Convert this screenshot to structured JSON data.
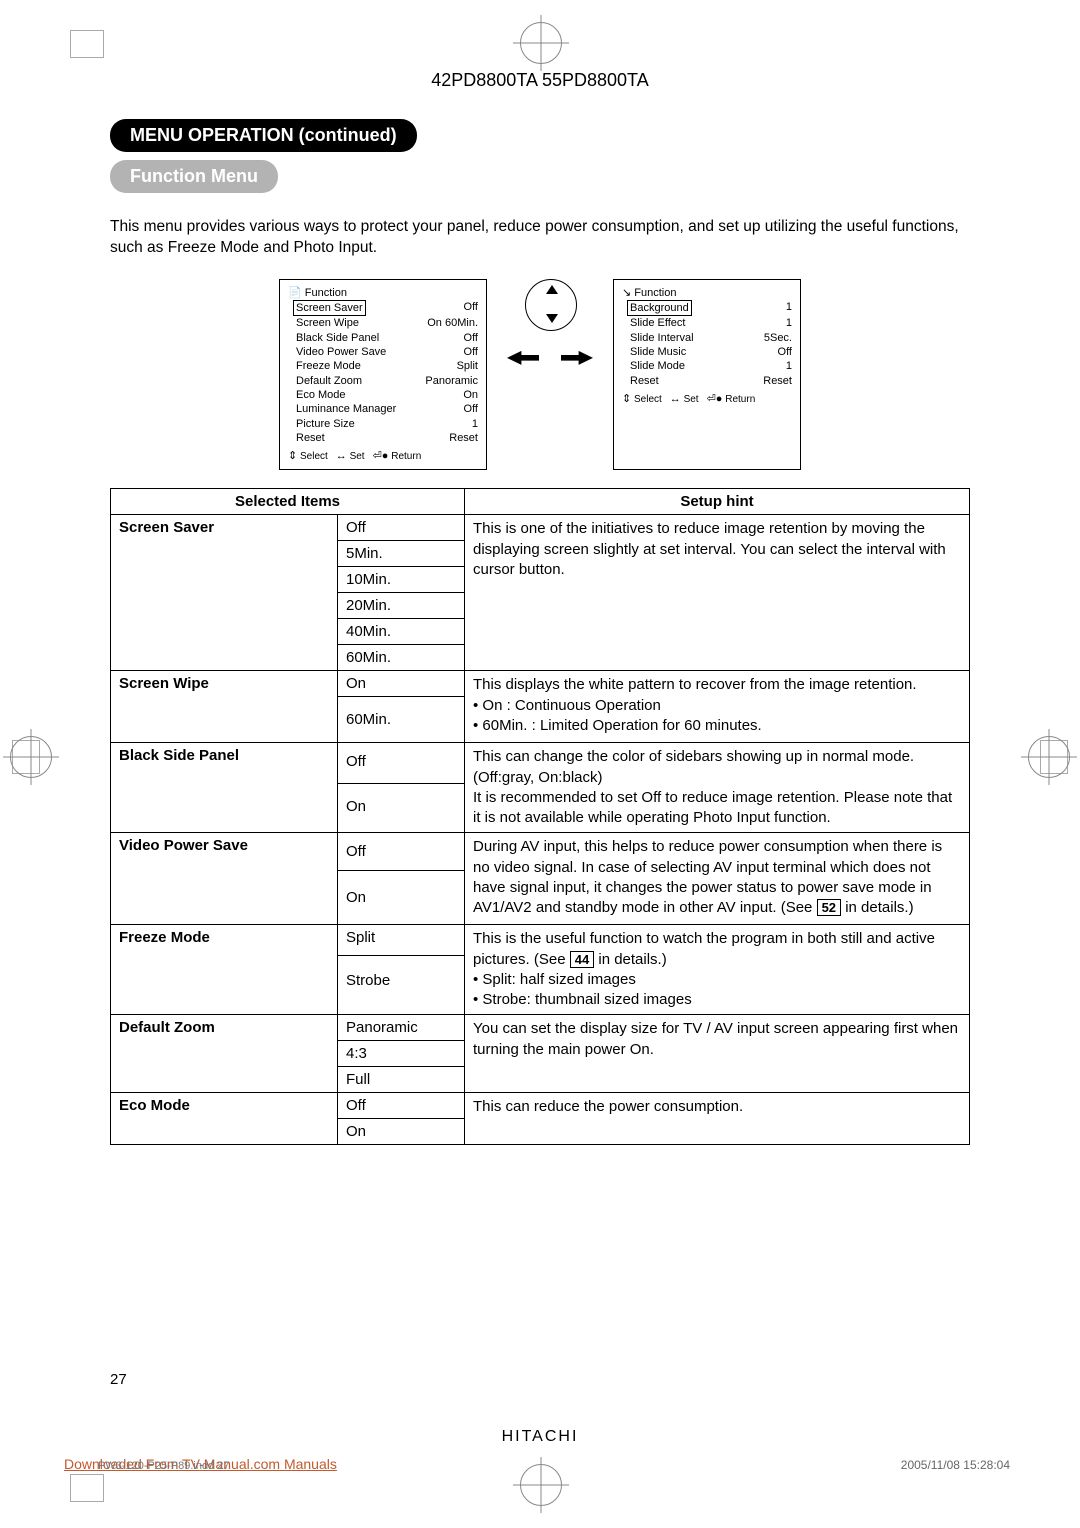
{
  "doc": {
    "model": "42PD8800TA  55PD8800TA",
    "title_pill": "MENU OPERATION (continued)",
    "subtitle_pill": "Function Menu",
    "intro": "This menu provides various ways to protect your panel, reduce power consumption, and set up utilizing the useful functions, such as Freeze Mode and Photo Input.",
    "page_number": "27",
    "brand": "HITACHI",
    "download_link": "Downloaded From TV-Manual.com Manuals",
    "imprint": "PW3-120-P25-P89.indd   27",
    "print_date": "2005/11/08   15:28:04"
  },
  "osd1": {
    "title": "Function",
    "rows": [
      {
        "label": "Screen Saver",
        "value": "Off",
        "selected": true
      },
      {
        "label": "Screen Wipe",
        "value": "On 60Min."
      },
      {
        "label": "Black Side Panel",
        "value": "Off"
      },
      {
        "label": "Video Power Save",
        "value": "Off"
      },
      {
        "label": "Freeze Mode",
        "value": "Split"
      },
      {
        "label": "Default Zoom",
        "value": "Panoramic"
      },
      {
        "label": "Eco Mode",
        "value": "On"
      },
      {
        "label": "Luminance Manager",
        "value": "Off"
      },
      {
        "label": "Picture Size",
        "value": "1"
      },
      {
        "label": "Reset",
        "value": "Reset"
      }
    ],
    "hints": {
      "select": "Select",
      "set": "Set",
      "ret": "Return"
    }
  },
  "osd2": {
    "title": "Function",
    "rows": [
      {
        "label": "Background",
        "value": "1",
        "selected": true
      },
      {
        "label": "Slide Effect",
        "value": "1"
      },
      {
        "label": "Slide Interval",
        "value": "5Sec."
      },
      {
        "label": "Slide Music",
        "value": "Off"
      },
      {
        "label": "Slide Mode",
        "value": "1"
      },
      {
        "label": "Reset",
        "value": "Reset"
      }
    ],
    "hints": {
      "select": "Select",
      "set": "Set",
      "ret": "Return"
    }
  },
  "table": {
    "head_items": "Selected Items",
    "head_hint": "Setup hint",
    "screen_saver": {
      "name": "Screen Saver",
      "opts": [
        "Off",
        "5Min.",
        "10Min.",
        "20Min.",
        "40Min.",
        "60Min."
      ],
      "hint": "This is one of the initiatives to reduce image retention by moving the displaying screen slightly at set interval. You can select the interval with cursor button."
    },
    "screen_wipe": {
      "name": "Screen Wipe",
      "opts": [
        "On",
        "60Min."
      ],
      "hint_a": "This displays the white pattern to recover from the image retention.",
      "hint_b": "• On : Continuous Operation",
      "hint_c": "• 60Min. : Limited Operation for 60 minutes."
    },
    "black_side": {
      "name": "Black Side Panel",
      "opts": [
        "Off",
        "On"
      ],
      "hint_a": "This can change the color of sidebars showing up in normal mode. (Off:gray, On:black)",
      "hint_b": "It is recommended to set Off to reduce image retention. Please note that it is not available while operating Photo Input function."
    },
    "vps": {
      "name": "Video Power Save",
      "opts": [
        "Off",
        "On"
      ],
      "hint_a": "During AV input, this helps to reduce power consumption when there is no video signal. In case of selecting AV input terminal which does not have signal input, it changes the power status to power save mode in AV1/AV2 and standby mode in other AV input. (See ",
      "pgref": "52",
      "hint_b": " in details.)"
    },
    "freeze": {
      "name": "Freeze Mode",
      "opts": [
        "Split",
        "Strobe"
      ],
      "hint_a": "This is the useful function to watch the program in both still and active pictures. (See ",
      "pgref": "44",
      "hint_b": " in details.)",
      "hint_c": "• Split: half sized images",
      "hint_d": "• Strobe: thumbnail sized images"
    },
    "zoom": {
      "name": "Default Zoom",
      "opts": [
        "Panoramic",
        "4:3",
        "Full"
      ],
      "hint": "You can set the display size for TV / AV input screen appearing first when turning the main power On."
    },
    "eco": {
      "name": "Eco Mode",
      "opts": [
        "Off",
        "On"
      ],
      "hint": "This can reduce the power consumption."
    }
  }
}
